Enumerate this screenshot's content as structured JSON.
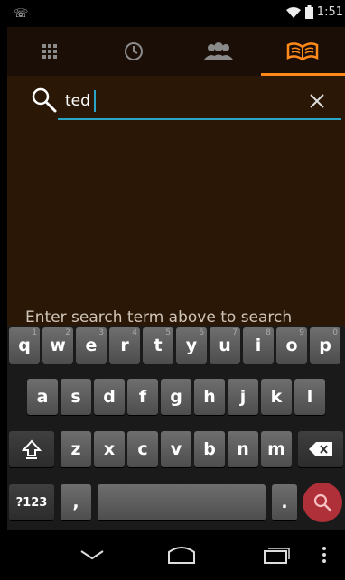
{
  "status_bar": {
    "time": "1:51"
  },
  "tabs": [
    {
      "name": "dialpad",
      "icon": "dialpad-icon",
      "active": false
    },
    {
      "name": "recent",
      "icon": "clock-icon",
      "active": false
    },
    {
      "name": "contacts",
      "icon": "contacts-icon",
      "active": false
    },
    {
      "name": "directory",
      "icon": "book-icon",
      "active": true
    }
  ],
  "search": {
    "value": "ted",
    "hint": "Enter search term above to search"
  },
  "keyboard": {
    "row1": [
      {
        "k": "q",
        "n": "1"
      },
      {
        "k": "w",
        "n": "2"
      },
      {
        "k": "e",
        "n": "3"
      },
      {
        "k": "r",
        "n": "4"
      },
      {
        "k": "t",
        "n": "5"
      },
      {
        "k": "y",
        "n": "6"
      },
      {
        "k": "u",
        "n": "7"
      },
      {
        "k": "i",
        "n": "8"
      },
      {
        "k": "o",
        "n": "9"
      },
      {
        "k": "p",
        "n": "0"
      }
    ],
    "row2": [
      "a",
      "s",
      "d",
      "f",
      "g",
      "h",
      "j",
      "k",
      "l"
    ],
    "row3": [
      "z",
      "x",
      "c",
      "v",
      "b",
      "n",
      "m"
    ],
    "symbols_label": "?123",
    "comma_label": ",",
    "period_label": "."
  },
  "colors": {
    "accent": "#ff8a1a",
    "content_bg": "#2a1706",
    "search_underline": "#2aa5c5",
    "go_button": "#b0303a"
  }
}
